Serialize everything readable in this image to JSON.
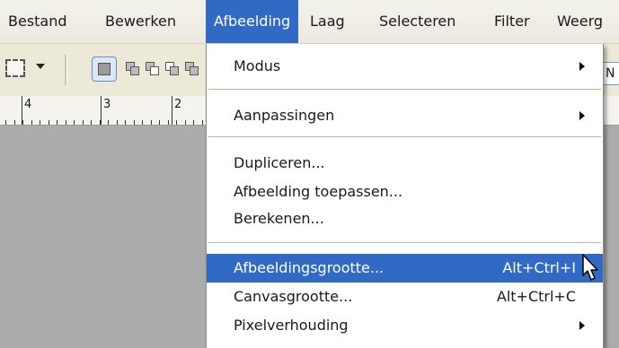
{
  "menubar": {
    "items": [
      {
        "label": "Bestand"
      },
      {
        "label": "Bewerken"
      },
      {
        "label": "Afbeelding",
        "active": true
      },
      {
        "label": "Laag"
      },
      {
        "label": "Selecteren"
      },
      {
        "label": "Filter"
      },
      {
        "label": "Weerg"
      }
    ]
  },
  "toolbar": {
    "field_text": "N"
  },
  "ruler": {
    "numbers": [
      "4",
      "3",
      "2"
    ]
  },
  "dropdown": {
    "items": [
      {
        "label": "Modus",
        "submenu": true
      },
      {
        "label": "Aanpassingen",
        "submenu": true
      },
      {
        "label": "Dupliceren..."
      },
      {
        "label": "Afbeelding toepassen..."
      },
      {
        "label": "Berekenen..."
      },
      {
        "label": "Afbeeldingsgrootte...",
        "shortcut": "Alt+Ctrl+I",
        "highlighted": true
      },
      {
        "label": "Canvasgrootte...",
        "shortcut": "Alt+Ctrl+C"
      },
      {
        "label": "Pixelverhouding",
        "submenu": true
      }
    ]
  },
  "colors": {
    "highlight": "#316ac5",
    "menubar_bg": "#ece9d8",
    "workspace_bg": "#ababab"
  }
}
